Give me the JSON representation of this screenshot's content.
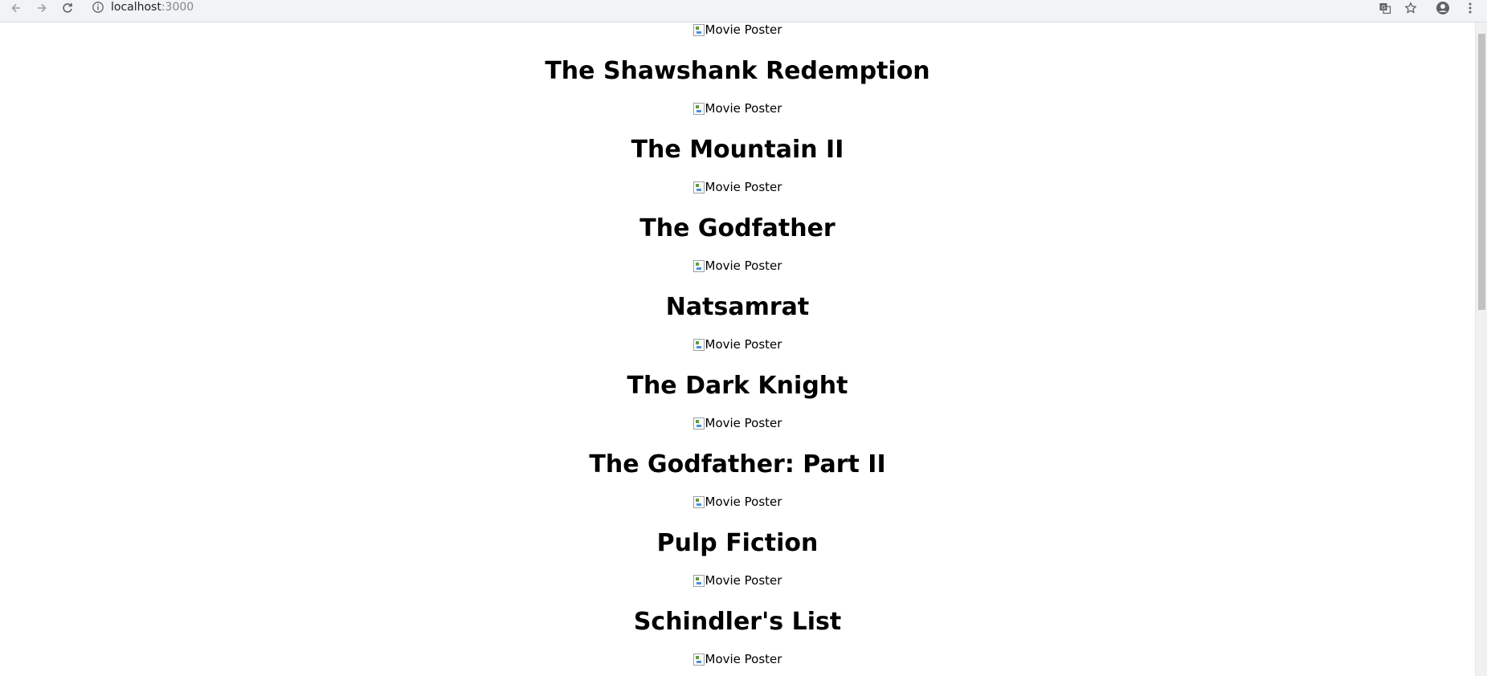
{
  "browser": {
    "url_host": "localhost",
    "url_port": ":3000"
  },
  "movies": [
    {
      "poster_alt": "Movie Poster",
      "title": "The Shawshank Redemption"
    },
    {
      "poster_alt": "Movie Poster",
      "title": "The Mountain II"
    },
    {
      "poster_alt": "Movie Poster",
      "title": "The Godfather"
    },
    {
      "poster_alt": "Movie Poster",
      "title": "Natsamrat"
    },
    {
      "poster_alt": "Movie Poster",
      "title": "The Dark Knight"
    },
    {
      "poster_alt": "Movie Poster",
      "title": "The Godfather: Part II"
    },
    {
      "poster_alt": "Movie Poster",
      "title": "Pulp Fiction"
    },
    {
      "poster_alt": "Movie Poster",
      "title": "Schindler's List"
    },
    {
      "poster_alt": "Movie Poster",
      "title": ""
    }
  ]
}
